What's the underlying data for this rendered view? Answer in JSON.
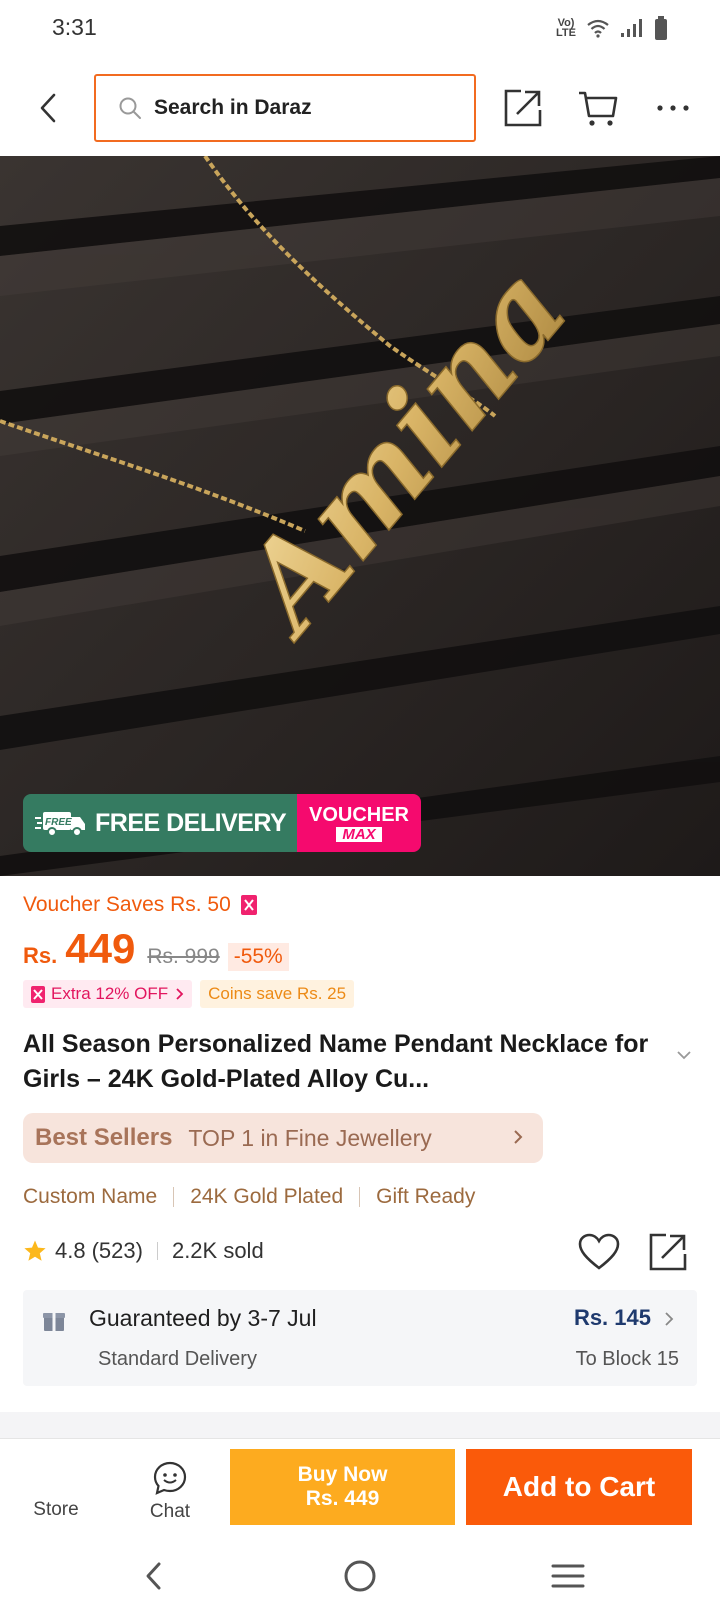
{
  "status_bar": {
    "time": "3:31",
    "network": "LTE"
  },
  "header": {
    "search_placeholder": "Search in Daraz"
  },
  "hero": {
    "pendant_text": "Amina",
    "promo": {
      "free_badge": "FREE",
      "free_delivery": "FREE DELIVERY",
      "voucher_top": "VOUCHER",
      "voucher_bottom": "MAX"
    }
  },
  "product": {
    "voucher_saves": "Voucher Saves Rs. 50",
    "currency": "Rs.",
    "price": "449",
    "original_price": "Rs. 999",
    "discount": "-55%",
    "extra_off": "Extra 12% OFF",
    "coins_save": "Coins save Rs. 25",
    "title": "All Season Personalized Name Pendant Necklace for Girls – 24K Gold-Plated Alloy Cu...",
    "best_sellers_label": "Best Sellers",
    "best_sellers_rank": "TOP 1 in Fine Jewellery",
    "tags": [
      "Custom Name",
      "24K Gold Plated",
      "Gift Ready"
    ],
    "rating": "4.8",
    "reviews": "(523)",
    "sold": "2.2K sold"
  },
  "delivery": {
    "guarantee": "Guaranteed by 3-7 Jul",
    "method": "Standard Delivery",
    "fee": "Rs. 145",
    "destination": "To Block 15"
  },
  "bottom_bar": {
    "store_label": "Store",
    "chat_label": "Chat",
    "buy_now_label": "Buy Now",
    "buy_now_price": "Rs. 449",
    "add_to_cart_label": "Add to Cart"
  },
  "colors": {
    "accent": "#f05a0d",
    "buy_now": "#fdab1f",
    "add_to_cart": "#fa5a0a",
    "promo_green": "#357b61",
    "promo_pink": "#f50a6e"
  }
}
